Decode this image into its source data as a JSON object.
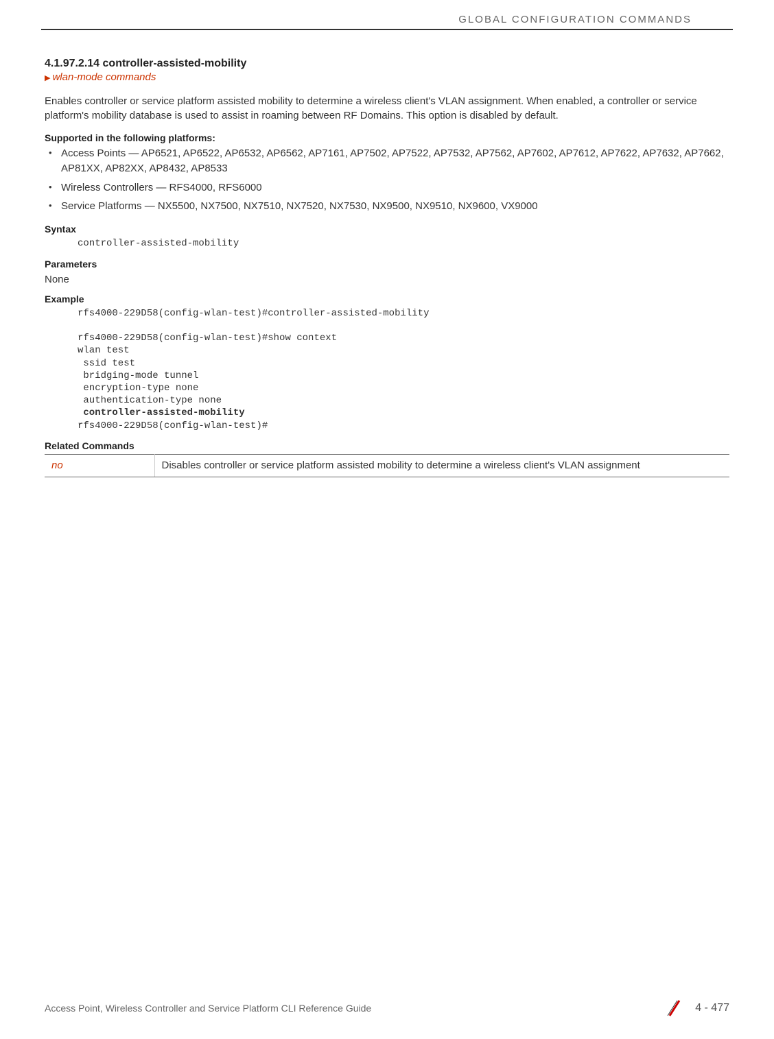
{
  "header": {
    "category": "GLOBAL CONFIGURATION COMMANDS"
  },
  "section": {
    "number": "4.1.97.2.14",
    "title": "controller-assisted-mobility",
    "breadcrumb": "wlan-mode commands"
  },
  "description": "Enables controller or service platform assisted mobility to determine a wireless client's VLAN assignment. When enabled, a controller or service platform's mobility database is used to assist in roaming between RF Domains. This option is disabled by default.",
  "platforms": {
    "heading": "Supported in the following platforms:",
    "items": [
      "Access Points — AP6521, AP6522, AP6532, AP6562, AP7161, AP7502, AP7522, AP7532, AP7562, AP7602, AP7612, AP7622, AP7632, AP7662, AP81XX, AP82XX, AP8432, AP8533",
      "Wireless Controllers — RFS4000, RFS6000",
      "Service Platforms — NX5500, NX7500, NX7510, NX7520, NX7530, NX9500, NX9510, NX9600, VX9000"
    ]
  },
  "syntax": {
    "heading": "Syntax",
    "code": "controller-assisted-mobility"
  },
  "parameters": {
    "heading": "Parameters",
    "value": "None"
  },
  "example": {
    "heading": "Example",
    "line1": "rfs4000-229D58(config-wlan-test)#controller-assisted-mobility",
    "line2": "rfs4000-229D58(config-wlan-test)#show context",
    "line3": "wlan test",
    "line4": " ssid test",
    "line5": " bridging-mode tunnel",
    "line6": " encryption-type none",
    "line7": " authentication-type none",
    "line8": " controller-assisted-mobility",
    "line9": "rfs4000-229D58(config-wlan-test)#"
  },
  "related": {
    "heading": "Related Commands",
    "command": "no",
    "description": "Disables controller or service platform assisted mobility to determine a wireless client's VLAN assignment"
  },
  "footer": {
    "doc_title": "Access Point, Wireless Controller and Service Platform CLI Reference Guide",
    "page": "4 - 477"
  }
}
